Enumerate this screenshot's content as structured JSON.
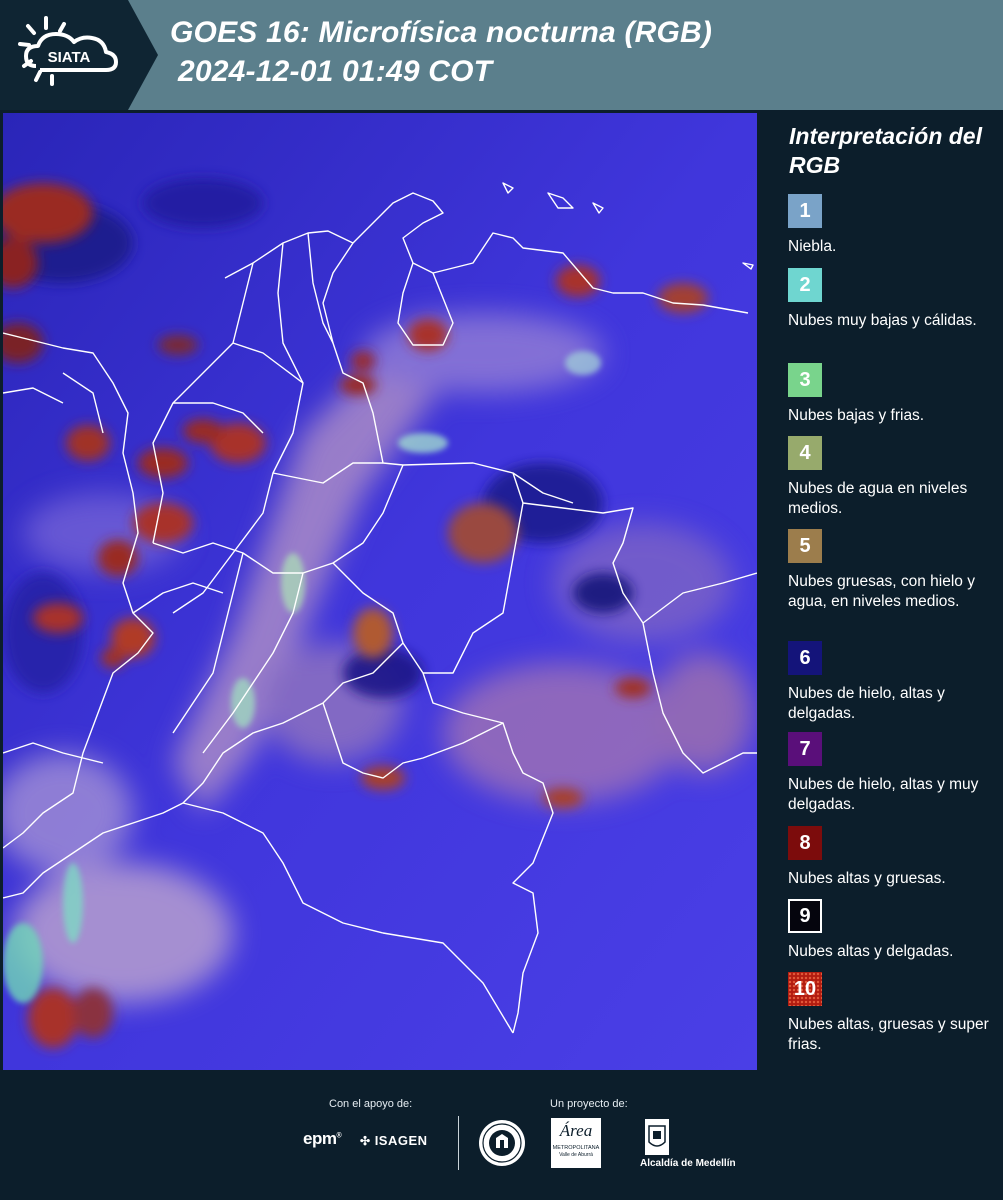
{
  "header": {
    "logo_text": "SIATA",
    "title_line1": "GOES 16: Microfísica nocturna (RGB)",
    "title_line2": "2024-12-01 01:49 COT"
  },
  "map": {
    "icon": "satellite-rgb-map",
    "colors": {
      "background": "#3b34d8",
      "border_lines": "#ffffff",
      "frame": "#0c1e2b"
    }
  },
  "legend": {
    "title": "Interpretación del RGB",
    "items": [
      {
        "number": "1",
        "label": "Niebla.",
        "color": "#7aa3c8"
      },
      {
        "number": "2",
        "label": "Nubes muy bajas y cálidas.",
        "color": "#6fd6d0"
      },
      {
        "number": "3",
        "label": "Nubes bajas y frias.",
        "color": "#79d48c"
      },
      {
        "number": "4",
        "label": "Nubes de agua en niveles medios.",
        "color": "#97aa6c"
      },
      {
        "number": "5",
        "label": "Nubes gruesas, con hielo y agua, en niveles medios.",
        "color": "#9c7d4c"
      },
      {
        "number": "6",
        "label": "Nubes de hielo, altas y delgadas.",
        "color": "#14147a"
      },
      {
        "number": "7",
        "label": "Nubes de hielo, altas y muy delgadas.",
        "color": "#5a0f7a"
      },
      {
        "number": "8",
        "label": "Nubes altas y gruesas.",
        "color": "#7c0c0c"
      },
      {
        "number": "9",
        "label": "Nubes altas y delgadas.",
        "color": "#05050d"
      },
      {
        "number": "10",
        "label": "Nubes altas, gruesas y super frias.",
        "color": "#b21c10"
      }
    ]
  },
  "footer": {
    "support_caption": "Con el apoyo de:",
    "project_caption": "Un proyecto de:",
    "sponsor_epm": "epm",
    "sponsor_isagen": "ISAGEN",
    "area_logo_text": "Área",
    "area_logo_subtext": "METROPOLITANA",
    "area_logo_subtext2": "Valle de Aburrá",
    "alcaldia_label": "Alcaldía de Medellín"
  }
}
